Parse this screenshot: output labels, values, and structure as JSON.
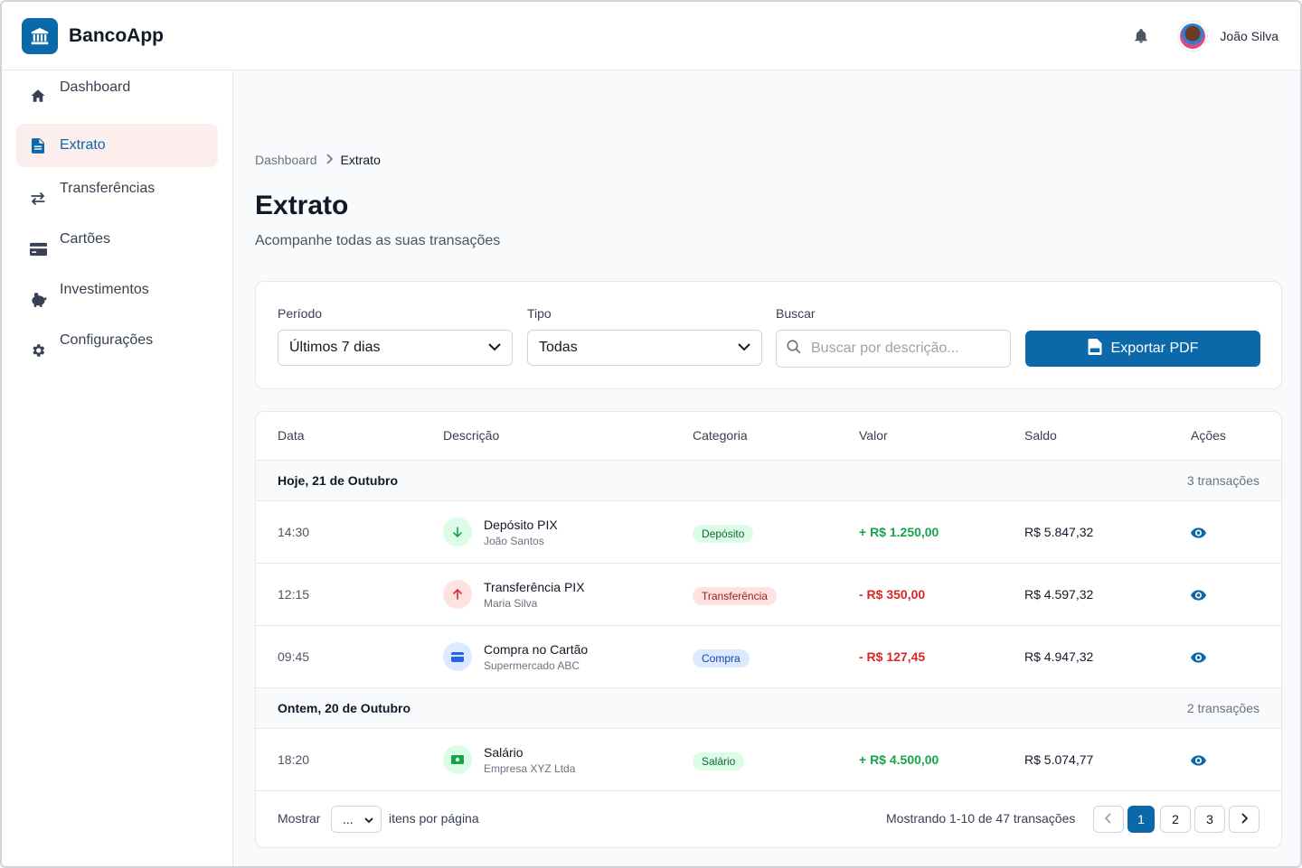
{
  "app": {
    "name": "BancoApp"
  },
  "user": {
    "name": "João Silva"
  },
  "sidebar": {
    "items": [
      {
        "label": "Dashboard",
        "icon": "home-icon"
      },
      {
        "label": "Extrato",
        "icon": "document-icon",
        "active": true
      },
      {
        "label": "Transferências",
        "icon": "arrows-icon"
      },
      {
        "label": "Cartões",
        "icon": "credit-card-icon"
      },
      {
        "label": "Investimentos",
        "icon": "piggy-bank-icon"
      },
      {
        "label": "Configurações",
        "icon": "gear-icon"
      }
    ]
  },
  "breadcrumb": {
    "parent": "Dashboard",
    "current": "Extrato"
  },
  "page": {
    "title": "Extrato",
    "subtitle": "Acompanhe todas as suas transações"
  },
  "filters": {
    "period": {
      "label": "Período",
      "value": "Últimos 7 dias"
    },
    "type": {
      "label": "Tipo",
      "value": "Todas"
    },
    "search": {
      "label": "Buscar",
      "placeholder": "Buscar por descrição..."
    },
    "export_label": "Exportar PDF"
  },
  "table": {
    "columns": [
      "Data",
      "Descrição",
      "Categoria",
      "Valor",
      "Saldo",
      "Ações"
    ],
    "groups": [
      {
        "title": "Hoje, 21 de Outubro",
        "count": "3 transações",
        "rows": [
          {
            "time": "14:30",
            "title": "Depósito PIX",
            "subtitle": "João Santos",
            "category": "Depósito",
            "amount": "+ R$ 1.250,00",
            "balance": "R$ 5.847,32",
            "icon": "arrow-down-icon"
          },
          {
            "time": "12:15",
            "title": "Transferência PIX",
            "subtitle": "Maria Silva",
            "category": "Transferência",
            "amount": "- R$ 350,00",
            "balance": "R$ 4.597,32",
            "icon": "arrow-up-icon"
          },
          {
            "time": "09:45",
            "title": "Compra no Cartão",
            "subtitle": "Supermercado ABC",
            "category": "Compra",
            "amount": "- R$ 127,45",
            "balance": "R$ 4.947,32",
            "icon": "card-icon"
          }
        ]
      },
      {
        "title": "Ontem, 20 de Outubro",
        "count": "2 transações",
        "rows": [
          {
            "time": "18:20",
            "title": "Salário",
            "subtitle": "Empresa XYZ Ltda",
            "category": "Salário",
            "amount": "+ R$ 4.500,00",
            "balance": "R$ 5.074,77",
            "icon": "money-icon"
          }
        ]
      }
    ]
  },
  "pagination": {
    "show_label": "Mostrar",
    "per_page_value": "...",
    "per_page_suffix": "itens por página",
    "summary": "Mostrando 1-10 de 47 transações",
    "pages": [
      "1",
      "2",
      "3"
    ],
    "current_page": "1"
  },
  "colors": {
    "primary": "#0b69a9",
    "positive": "#16a34a",
    "negative": "#dc2626",
    "active_nav_bg": "#fdeeee"
  }
}
